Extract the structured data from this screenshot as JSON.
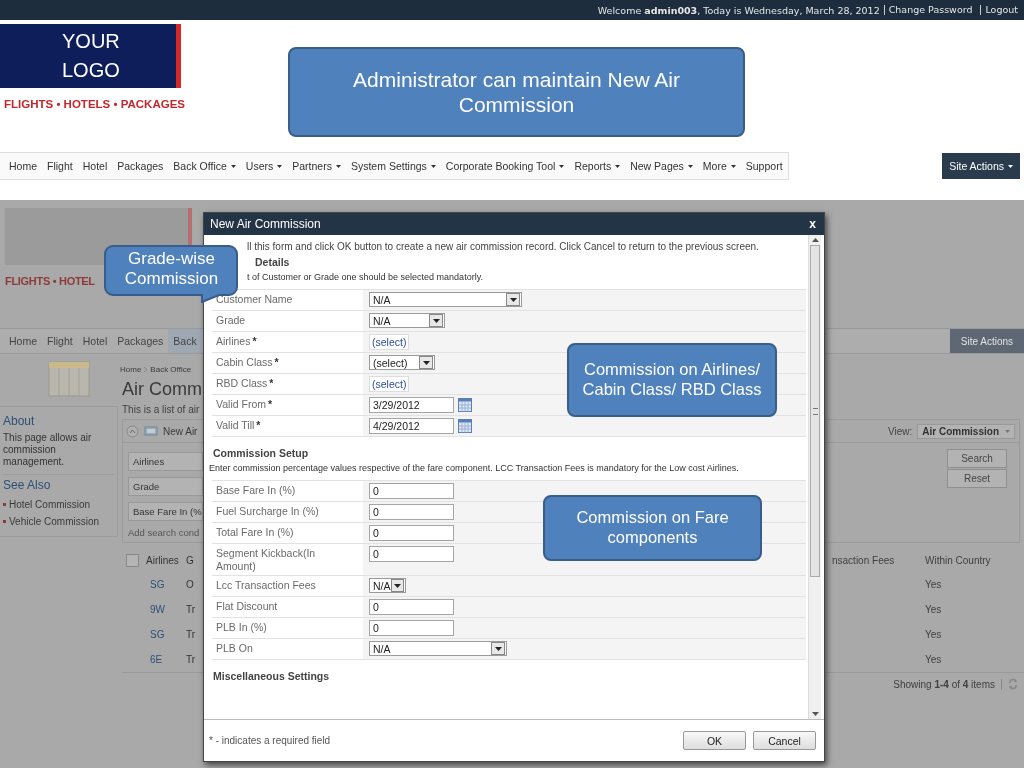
{
  "top_bar": {
    "welcome": "Welcome **admin003**, Today is Wednesday, March 28, 2012",
    "links": [
      "Change Password",
      "Logout"
    ]
  },
  "logo": {
    "lines": [
      "YOUR",
      "LOGO"
    ],
    "tagline": "FLIGHTS • HOTELS • PACKAGES"
  },
  "callouts": [
    {
      "text": "Administrator can maintain New Air Commission",
      "kind": "box"
    },
    {
      "text": "Grade-wise Commission",
      "kind": "pointer"
    },
    {
      "text": "Commission on Airlines/ Cabin Class/ RBD Class",
      "kind": "box"
    },
    {
      "text": "Commission on Fare components",
      "kind": "box"
    }
  ],
  "nav": {
    "items": [
      {
        "label": "Home",
        "dropdown": false
      },
      {
        "label": "Flight",
        "dropdown": false
      },
      {
        "label": "Hotel",
        "dropdown": false
      },
      {
        "label": "Packages",
        "dropdown": false
      },
      {
        "label": "Back Office",
        "dropdown": true
      },
      {
        "label": "Users",
        "dropdown": true
      },
      {
        "label": "Partners",
        "dropdown": true
      },
      {
        "label": "System Settings",
        "dropdown": true
      },
      {
        "label": "Corporate Booking Tool",
        "dropdown": true
      },
      {
        "label": "Reports",
        "dropdown": true
      },
      {
        "label": "New Pages",
        "dropdown": true
      },
      {
        "label": "More",
        "dropdown": true
      },
      {
        "label": "Support",
        "dropdown": false
      }
    ],
    "site_actions": "Site Actions"
  },
  "background_page": {
    "tagline": "FLIGHTS • HOTEL",
    "nav_items": [
      {
        "label": "Home",
        "selected": false
      },
      {
        "label": "Flight",
        "selected": false
      },
      {
        "label": "Hotel",
        "selected": false
      },
      {
        "label": "Packages",
        "selected": false
      },
      {
        "label": "Back",
        "selected": true
      }
    ],
    "site_actions": "Site Actions",
    "about": {
      "heading": "About",
      "text": "This page allows air commission management."
    },
    "see_also": {
      "heading": "See Also",
      "links": [
        "Hotel Commission",
        "Vehicle Commission"
      ]
    },
    "breadcrumb": [
      "Home",
      "Back Office"
    ],
    "title": "Air Comm",
    "description": "This is a list of air",
    "new_button": "New Air",
    "filters": [
      "Airlines",
      "Grade",
      "Base Fare In (%"
    ],
    "add_condition": "Add search cond",
    "view_label": "View:",
    "view_value": "Air Commission",
    "search_button": "Search",
    "reset_button": "Reset",
    "select_all": {
      "checked": false
    },
    "table": {
      "columns_left": [
        "Airlines",
        "G"
      ],
      "columns_right": [
        "nsaction Fees",
        "Within Country"
      ],
      "rows": [
        {
          "left": [
            "SG",
            "O"
          ],
          "right": "Yes"
        },
        {
          "left": [
            "9W",
            "Tr"
          ],
          "right": "Yes"
        },
        {
          "left": [
            "SG",
            "Tr"
          ],
          "right": "Yes"
        },
        {
          "left": [
            "6E",
            "Tr"
          ],
          "right": "Yes"
        }
      ]
    },
    "paging": "Showing **1-4** of **4** items"
  },
  "dialog": {
    "title": "New Air Commission",
    "close": "x",
    "intro": "ll this form and click OK button to create a new air commission record. Click Cancel to return to the previous screen.",
    "sections": [
      {
        "heading": "Details",
        "note": "t of Customer or Grade one should be selected mandatorly.",
        "fields": [
          {
            "label": "Customer Name",
            "kind": "select",
            "value": "N/A"
          },
          {
            "label": "Grade",
            "kind": "select",
            "value": "N/A"
          },
          {
            "label": "Airlines",
            "mark": "*",
            "kind": "link",
            "value": "(select)"
          },
          {
            "label": "Cabin Class",
            "mark": "*",
            "kind": "select",
            "value": "(select)"
          },
          {
            "label": "RBD Class",
            "mark": "*",
            "kind": "link",
            "value": "(select)"
          },
          {
            "label": "Valid From",
            "mark": "*",
            "kind": "date",
            "value": "3/29/2012"
          },
          {
            "label": "Valid Till",
            "mark": "*",
            "kind": "date",
            "value": "4/29/2012"
          }
        ]
      },
      {
        "heading": "Commission Setup",
        "note": "Enter commission percentage values respective of the fare component. LCC Transaction Fees is mandatory for the Low cost Airlines.",
        "fields": [
          {
            "label": "Base Fare In (%)",
            "kind": "text",
            "value": "0"
          },
          {
            "label": "Fuel Surcharge In (%)",
            "kind": "text",
            "value": "0"
          },
          {
            "label": "Total Fare In (%)",
            "kind": "text",
            "value": "0"
          },
          {
            "label": "Segment Kickback(In Amount)",
            "kind": "text",
            "value": "0"
          },
          {
            "label": "Lcc Transaction Fees",
            "kind": "select",
            "value": "N/A"
          },
          {
            "label": "Flat Discount",
            "kind": "text",
            "value": "0"
          },
          {
            "label": "PLB In (%)",
            "kind": "text",
            "value": "0"
          },
          {
            "label": "PLB On",
            "kind": "select",
            "value": "N/A"
          }
        ]
      },
      {
        "heading": "Miscellaneous Settings"
      }
    ],
    "required_note": "* - indicates a required field",
    "buttons": [
      "OK",
      "Cancel"
    ]
  }
}
